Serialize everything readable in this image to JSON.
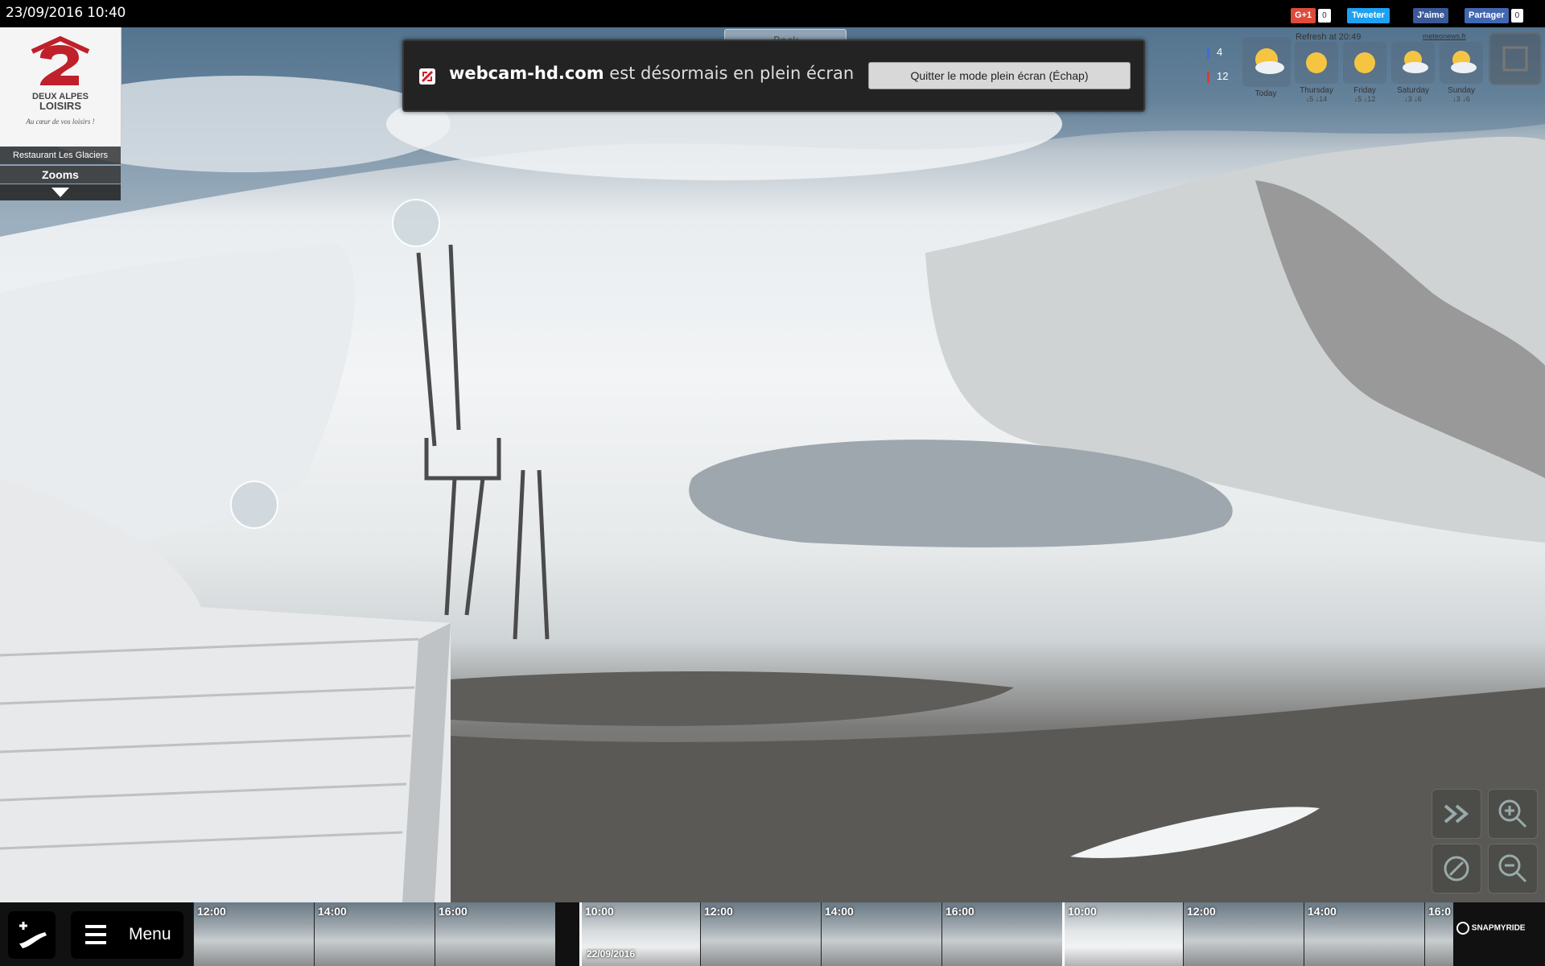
{
  "header": {
    "datetime": "23/09/2016 10:40",
    "social": {
      "gplus_label": "G+1",
      "gplus_count": "0",
      "tweet_label": "Tweeter",
      "like_label": "J'aime",
      "share_label": "Partager",
      "share_count": "0"
    }
  },
  "sidebar": {
    "logo_line1": "DEUX ALPES",
    "logo_line2": "LOISIRS",
    "logo_tagline": "Au cœur de vos loisirs !",
    "location": "Restaurant Les Glaciers",
    "zooms_label": "Zooms",
    "expand_icon": "triangle-down-icon"
  },
  "fullscreen_notice": {
    "site": "webcam-hd.com",
    "message": " est désormais en plein écran",
    "exit_label": "Quitter le mode plein écran (Échap)",
    "back_label": "Back"
  },
  "weather": {
    "temp_min": "4",
    "temp_max": "12",
    "refresh": "Refresh at 20:49",
    "source": "meteonews.fr",
    "days": [
      {
        "label": "Today",
        "min": "",
        "max": "",
        "icon": "sun-cloud-icon"
      },
      {
        "label": "Thursday",
        "min": "5",
        "max": "14",
        "icon": "sun-icon"
      },
      {
        "label": "Friday",
        "min": "5",
        "max": "12",
        "icon": "sun-icon"
      },
      {
        "label": "Saturday",
        "min": "3",
        "max": "6",
        "icon": "sun-cloud-icon"
      },
      {
        "label": "Sunday",
        "min": "3",
        "max": "6",
        "icon": "sun-cloud-icon"
      }
    ]
  },
  "timeline": {
    "menu_label": "Menu",
    "thumbs": [
      {
        "time": "12:00",
        "date": ""
      },
      {
        "time": "14:00",
        "date": ""
      },
      {
        "time": "16:00",
        "date": ""
      },
      {
        "time": "10:00",
        "date": "22/09/2016"
      },
      {
        "time": "12:00",
        "date": ""
      },
      {
        "time": "14:00",
        "date": ""
      },
      {
        "time": "16:00",
        "date": ""
      },
      {
        "time": "10:00",
        "date": ""
      },
      {
        "time": "12:00",
        "date": ""
      },
      {
        "time": "14:00",
        "date": ""
      },
      {
        "time": "16:0",
        "date": ""
      }
    ],
    "brand": "SNAPMYRIDE"
  },
  "colors": {
    "gplus": "#dd4b39",
    "twitter": "#1da1f2",
    "facebook": "#3b5998",
    "logo_red": "#c0202a",
    "temp_min": "#3a6fd8",
    "temp_max": "#d83a3a"
  }
}
